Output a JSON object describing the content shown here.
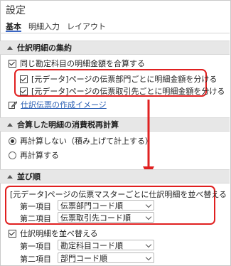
{
  "window": {
    "title": "設定"
  },
  "tabs": [
    {
      "label": "基本",
      "active": true
    },
    {
      "label": "明細入力",
      "active": false
    },
    {
      "label": "レイアウト",
      "active": false
    }
  ],
  "section_aggregate": {
    "header": "仕訳明細の集約",
    "option_main": {
      "label": "同じ勘定科目の明細金額を合算する",
      "checked": true
    },
    "option_dept": {
      "label": "[元データ]ページの伝票部門ごとに明細金額を分ける",
      "checked": true
    },
    "option_partner": {
      "label": "[元データ]ページの伝票取引先ごとに明細金額を分ける",
      "checked": true
    },
    "link_label": "仕訳伝票の作成イメージ"
  },
  "section_tax": {
    "header": "合算した明細の消費税再計算",
    "radio_no": {
      "label": "再計算しない（積み上げて計上する）",
      "checked": true
    },
    "radio_yes": {
      "label": "再計算する",
      "checked": false
    }
  },
  "section_sort": {
    "header": "並び順",
    "master_sort_label": "[元データ]ページの伝票マスターごとに仕訳明細を並べ替える",
    "master_first_label": "第一項目",
    "master_first_value": "伝票部門コード順",
    "master_second_label": "第二項目",
    "master_second_value": "伝票取引先コード順",
    "detail_sort": {
      "label": "仕訳明細を並べ替える",
      "checked": true
    },
    "detail_first_label": "第一項目",
    "detail_first_value": "勘定科目コード順",
    "detail_second_label": "第二項目",
    "detail_second_value": "部門コード順"
  },
  "colors": {
    "annotation": "#e02020",
    "link": "#2b5fb3",
    "tab_accent": "#3a66c4"
  }
}
